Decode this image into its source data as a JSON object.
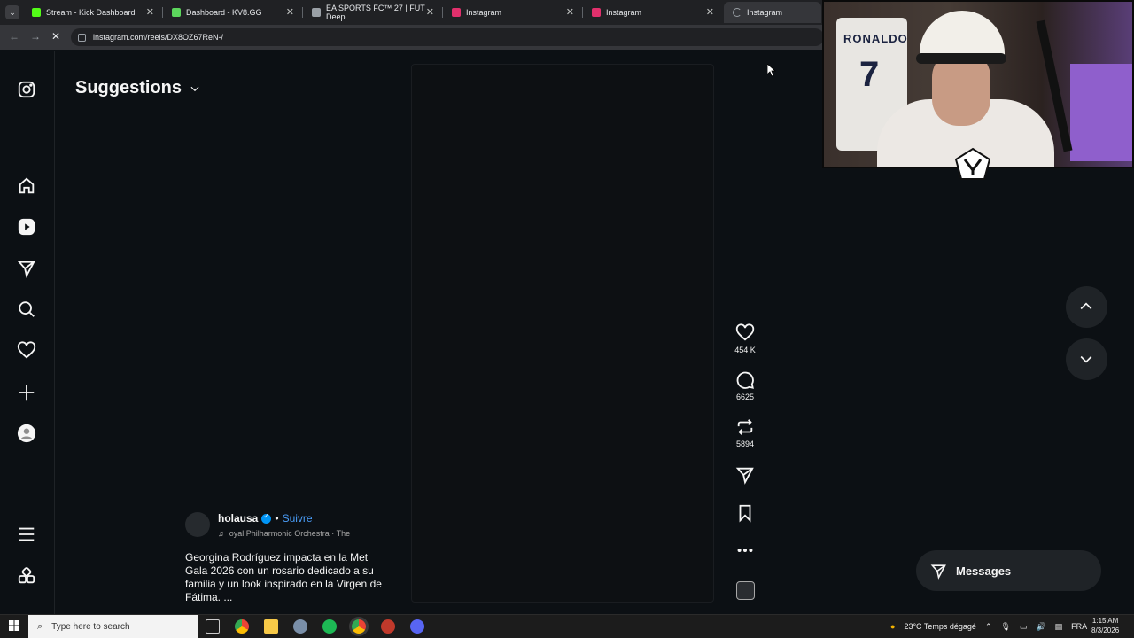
{
  "browser": {
    "tabs": [
      {
        "title": "Stream - Kick Dashboard",
        "fav_color": "#53fc18"
      },
      {
        "title": "Dashboard - KV8.GG",
        "fav_color": "#5cd65c"
      },
      {
        "title": "EA SPORTS FC™ 27 | FUT Deep",
        "fav_color": "#9aa0a6"
      },
      {
        "title": "Instagram",
        "fav_color": "#e1306c"
      },
      {
        "title": "Instagram",
        "fav_color": "#e1306c"
      },
      {
        "title": "Instagram",
        "fav_color": "#9aa0a6"
      }
    ],
    "url": "instagram.com/reels/DX8OZ67ReN-/"
  },
  "instagram": {
    "header_title": "Suggestions",
    "reel": {
      "author": "holausa",
      "separator": "•",
      "follow_label": "Suivre",
      "audio": "oyal Philharmonic Orchestra · The",
      "caption": "Georgina Rodríguez impacta en la Met Gala 2026 con un rosario dedicado a su familia y un look inspirado en la Virgen de Fátima. ..."
    },
    "actions": {
      "likes": "454 K",
      "comments": "6625",
      "reposts": "5894"
    },
    "messages_label": "Messages"
  },
  "webcam": {
    "jersey_name": "RONALDO",
    "jersey_number": "7"
  },
  "taskbar": {
    "search_placeholder": "Type here to search",
    "weather": "23°C  Temps dégagé",
    "language": "FRA",
    "time": "1:15 AM",
    "date": "8/3/2026"
  },
  "colors": {
    "background": "#0c1014",
    "accent_link": "#4a9df8",
    "verified": "#0095f6"
  }
}
